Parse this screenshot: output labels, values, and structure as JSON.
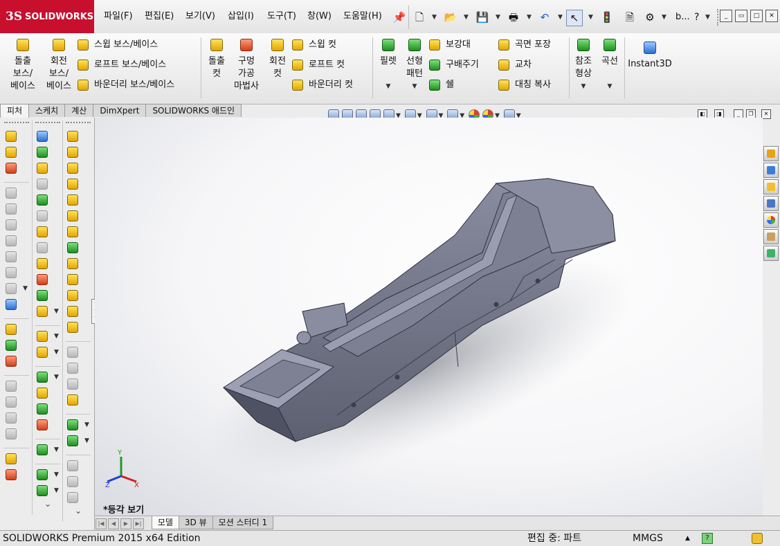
{
  "app": {
    "brand": "SOLIDWORKS",
    "brand_mark": "3S"
  },
  "menu": [
    "파일(F)",
    "편집(E)",
    "보기(V)",
    "삽입(I)",
    "도구(T)",
    "창(W)",
    "도움말(H)"
  ],
  "quick": {
    "search_text": "b...",
    "help": "?"
  },
  "features": {
    "extrude_boss": "돌출\n보스/\n베이스",
    "revolve_boss": "회전\n보스/\n베이스",
    "sweep_boss": "스윕 보스/베이스",
    "loft_boss": "로프트 보스/베이스",
    "boundary_boss": "바운더리 보스/베이스",
    "extrude_cut": "돌출\n컷",
    "hole_wizard": "구멍\n가공\n마법사",
    "revolve_cut": "회전\n컷",
    "sweep_cut": "스윕 컷",
    "loft_cut": "로프트 컷",
    "boundary_cut": "바운더리 컷",
    "fillet": "필렛",
    "linear_pattern": "선형\n패턴",
    "rib": "보강대",
    "draft": "구배주기",
    "shell": "쉘",
    "wrap": "곡면 포장",
    "intersect": "교차",
    "mirror": "대칭 복사",
    "ref_geometry": "참조\n형상",
    "curves": "곡선",
    "instant3d": "Instant3D"
  },
  "cmd_tabs": [
    "피처",
    "스케치",
    "계산",
    "DimXpert",
    "SOLIDWORKS 애드인"
  ],
  "view": {
    "orientation_label": "*등각 보기"
  },
  "triad": {
    "x": "X",
    "y": "Y",
    "z": "Z"
  },
  "bottom_tabs": [
    "모델",
    "3D 뷰",
    "모션 스터디 1"
  ],
  "status": {
    "edition": "SOLIDWORKS Premium 2015 x64 Edition",
    "mode": "편집 중: 파트",
    "units": "MMGS",
    "units_arrow": "▲",
    "help_icon_text": "?"
  },
  "colors": {
    "brand_red": "#c8102e",
    "part_gray": "#6e7180"
  }
}
